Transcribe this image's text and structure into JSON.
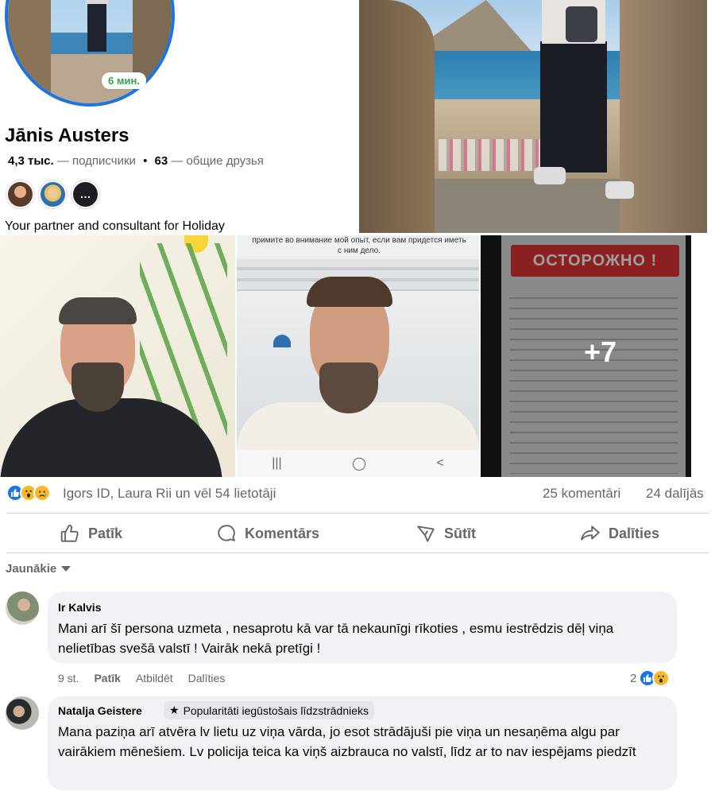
{
  "profile": {
    "time_badge": "6 мин.",
    "name": "Jānis Austers",
    "followers_count": "4,3 тыс.",
    "followers_label": "— подписчики",
    "dot": "•",
    "mutual_count": "63",
    "mutual_label": "— общие друзья",
    "more_icon": "…",
    "bio": "Your partner and consultant for Holiday"
  },
  "photo_text": {
    "selfie2_caption": "примите во внимание мой опыт, если вам придется иметь с ним дело.",
    "selfie2_nav": [
      "|||",
      "◯",
      "<"
    ],
    "warning_banner": "ОСТОРОЖНО !",
    "more_photos": "+7"
  },
  "reactions": {
    "icons": [
      "like-icon",
      "wow-icon",
      "sad-icon"
    ],
    "summary": "Igors ID, Laura Rii un vēl 54 lietotāji",
    "comments": "25 komentāri",
    "shares": "24 dalījās"
  },
  "actions": {
    "like": "Patīk",
    "comment": "Komentārs",
    "send": "Sūtīt",
    "share": "Dalīties"
  },
  "sort": {
    "label": "Jaunākie"
  },
  "comments": [
    {
      "author": "Ir Kalvis",
      "text": "Mani arī šī persona uzmeta , nesaprotu kā var tā nekaunīgi rīkoties , esmu iestrēdzis dēļ viņa nelietības svešā valstī ! Vairāk nekā pretīgi !",
      "time": "9 st.",
      "like": "Patīk",
      "reply": "Atbildēt",
      "share": "Dalīties",
      "reaction_count": "2"
    },
    {
      "author": "Natalja Geistere",
      "badge": "Popularitāti iegūstošais līdzstrādnieks",
      "text": "Mana paziņa arī atvēra lv lietu uz viņa vārda, jo esot strādājuši pie viņa un nesaņēma algu par vairākiem mēnešiem. Lv policija teica ka viņš aizbrauca no valstī, līdz ar to nav iespējams piedzīt"
    }
  ],
  "colors": {
    "accent": "#1b74e4",
    "online_green": "#31a24c",
    "muted_text": "#65676b",
    "bubble_bg": "#f0f2f5",
    "warning_red": "#e03434"
  }
}
